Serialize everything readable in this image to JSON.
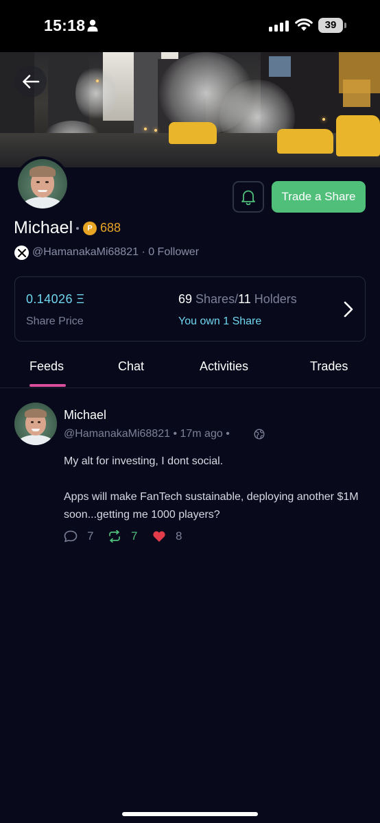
{
  "status_bar": {
    "time": "15:18",
    "battery": "39",
    "icons": [
      "person-icon",
      "signal-icon",
      "wifi-icon",
      "battery-icon"
    ]
  },
  "header": {
    "back_icon": "arrow-left-icon",
    "bell_icon": "bell-icon",
    "trade_button": "Trade a Share"
  },
  "profile": {
    "name": "Michael",
    "separator": "·",
    "points_badge": "P",
    "points": "688",
    "handle_line": "@HamanakaMi68821 · 0 Follower"
  },
  "stats": {
    "share_price": "0.14026 Ξ",
    "share_price_label": "Share Price",
    "shares_count": "69",
    "shares_label": " Shares/",
    "holders_count": "11",
    "holders_label": " Holders",
    "own_line": "You own 1 Share"
  },
  "tabs": [
    {
      "label": "Feeds",
      "active": true
    },
    {
      "label": "Chat",
      "active": false
    },
    {
      "label": "Activities",
      "active": false
    },
    {
      "label": "Trades",
      "active": false
    }
  ],
  "post": {
    "author": "Michael",
    "meta": "@HamanakaMi68821 • 17m ago •",
    "body_1": "My alt for investing, I dont social.",
    "body_2": "Apps will make FanTech sustainable, deploying another $1M soon...getting me 1000 players?",
    "replies": "7",
    "reposts": "7",
    "likes": "8"
  },
  "colors": {
    "background": "#080a1c",
    "accent_green": "#4fbf7a",
    "accent_cyan": "#6fd6ef",
    "accent_pink": "#d94f9c",
    "points_gold": "#e8a523",
    "like_red": "#e23b4a"
  }
}
